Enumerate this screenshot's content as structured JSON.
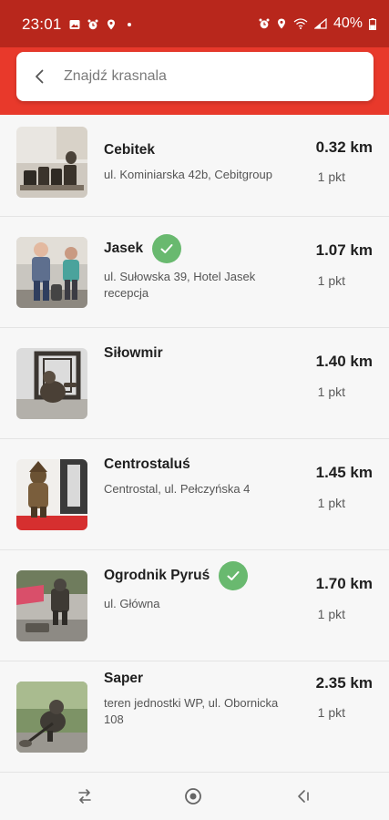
{
  "status_bar": {
    "time": "23:01",
    "battery": "40%",
    "left_icons": [
      "image-icon",
      "alarm-icon",
      "location-icon",
      "dot-icon"
    ],
    "right_icons": [
      "alarm-icon",
      "location-icon",
      "wifi-icon",
      "signal-icon",
      "battery-icon"
    ]
  },
  "search": {
    "placeholder": "Znajdź krasnala",
    "value": ""
  },
  "colors": {
    "header_red": "#e8392b",
    "status_bar_red": "#b8271c",
    "check_green": "#69b96f"
  },
  "gnomes": [
    {
      "name": "Cebitek",
      "address": "ul. Kominiarska 42b, Cebitgroup",
      "distance": "0.32 km",
      "points": "1 pkt",
      "visited": false
    },
    {
      "name": "Jasek",
      "address": "ul. Sułowska 39, Hotel Jasek recepcja",
      "distance": "1.07 km",
      "points": "1 pkt",
      "visited": true
    },
    {
      "name": "Siłowmir",
      "address": "",
      "distance": "1.40 km",
      "points": "1 pkt",
      "visited": false
    },
    {
      "name": "Centrostaluś",
      "address": "Centrostal, ul. Pełczyńska 4",
      "distance": "1.45 km",
      "points": "1 pkt",
      "visited": false
    },
    {
      "name": "Ogrodnik Pyruś",
      "address": "ul. Główna",
      "distance": "1.70 km",
      "points": "1 pkt",
      "visited": true
    },
    {
      "name": "Saper",
      "address": "teren jednostki WP, ul. Obornicka 108",
      "distance": "2.35 km",
      "points": "1 pkt",
      "visited": false
    }
  ],
  "nav_bar": [
    "recent-apps-icon",
    "home-icon",
    "back-icon"
  ]
}
